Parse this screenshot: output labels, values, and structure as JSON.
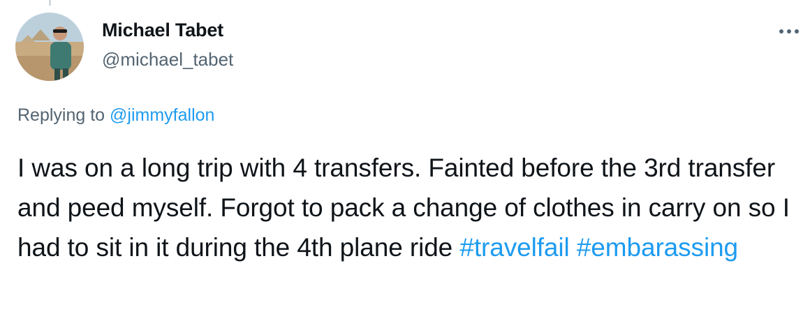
{
  "author": {
    "display_name": "Michael Tabet",
    "handle": "@michael_tabet"
  },
  "reply_context": {
    "prefix": "Replying to",
    "mention": "@jimmyfallon"
  },
  "tweet": {
    "text": "I was on a long trip with 4 transfers. Fainted before the 3rd transfer and peed myself. Forgot to pack a change of clothes in carry on so I had to sit in it during the 4th plane ride",
    "hashtags": [
      "#travelfail",
      "#embarassing"
    ]
  },
  "icons": {
    "more": "more-horizontal-icon",
    "avatar": "profile-photo"
  },
  "colors": {
    "link": "#1d9bf0",
    "secondary_text": "#536471",
    "primary_text": "#0f1419"
  }
}
